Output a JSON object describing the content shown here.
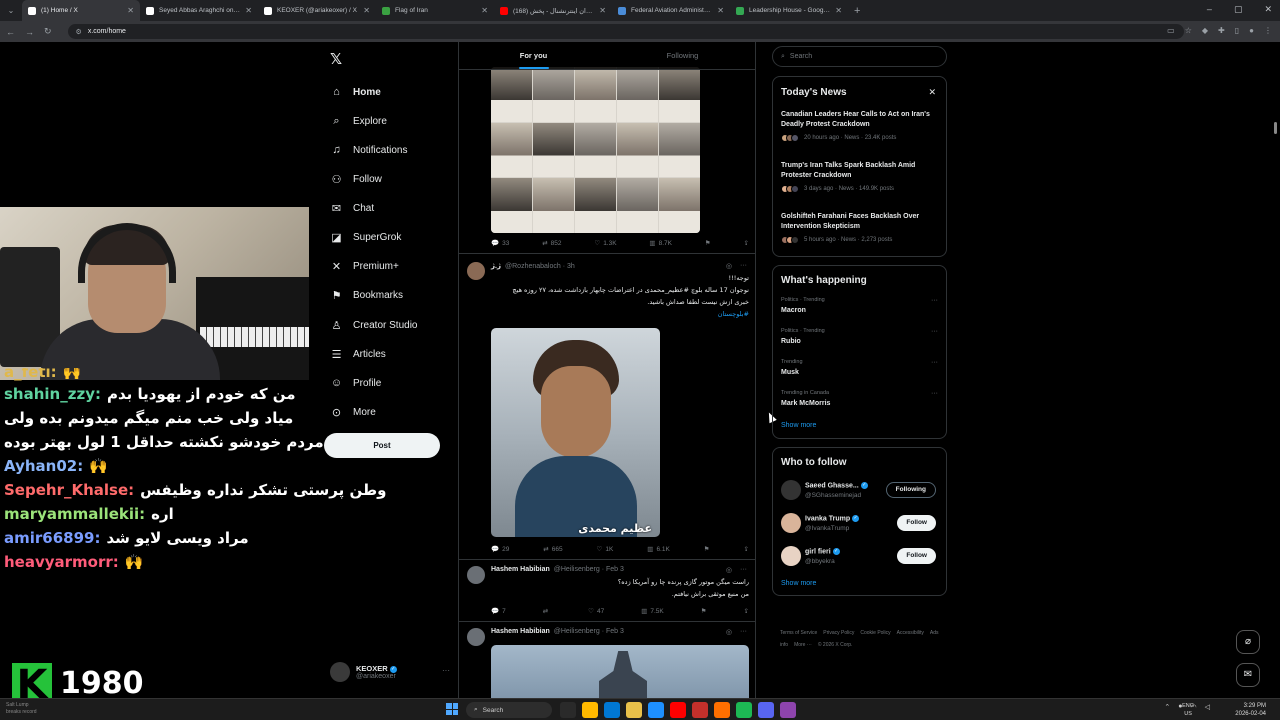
{
  "browser": {
    "tabs": [
      {
        "title": "(1) Home / X",
        "active": true,
        "favicon_color": "#ffffff"
      },
      {
        "title": "Seyed Abbas Araghchi on X: \"I...",
        "active": false,
        "favicon_color": "#ffffff"
      },
      {
        "title": "KEOXER (@ariakeoxer) / X",
        "active": false,
        "favicon_color": "#ffffff"
      },
      {
        "title": "Flag of Iran",
        "active": false,
        "favicon_color": "#3aa142"
      },
      {
        "title": "(168) ایران اینترنشنال - پخش...",
        "active": false,
        "favicon_color": "#ff0000"
      },
      {
        "title": "Federal Aviation Administratio...",
        "active": false,
        "favicon_color": "#4a8cd8"
      },
      {
        "title": "Leadership House - Google Ma...",
        "active": false,
        "favicon_color": "#34a853"
      }
    ],
    "new_tab_symbol": "+",
    "url": "x.com/home"
  },
  "stream": {
    "chat": [
      {
        "user": "a_feti:",
        "message": "🙌",
        "user_color": "#e0b84b",
        "partial": true
      },
      {
        "user": "shahin_zzy:",
        "message": "من که خودم از یهودیا بدم میاد ولی خب منم میگم میدونم بده ولی مردم خودشو نکشته حداقل 1 لول بهتر بوده",
        "user_color": "#5fd3a0"
      },
      {
        "user": "Ayhan02:",
        "message": "🙌",
        "user_color": "#8ab4f8"
      },
      {
        "user": "Sepehr_Khalse:",
        "message": "وطن پرستی تشکر نداره وظیفس",
        "user_color": "#ff6b6b"
      },
      {
        "user": "maryammallekii:",
        "message": "اره",
        "user_color": "#9be37a"
      },
      {
        "user": "amir66899:",
        "message": "مراد ویسی لایو شد",
        "user_color": "#7a9cff"
      },
      {
        "user": "heavyarmorr:",
        "message": "🙌",
        "user_color": "#ff5c7a"
      }
    ],
    "sub_badge": "K",
    "sub_count": "1980",
    "sub_caption": "breaks record"
  },
  "nav": {
    "items": [
      {
        "label": "Home",
        "icon": "home-icon",
        "glyph": "⌂",
        "active": true
      },
      {
        "label": "Explore",
        "icon": "search-icon",
        "glyph": "⌕"
      },
      {
        "label": "Notifications",
        "icon": "bell-icon",
        "glyph": "♫"
      },
      {
        "label": "Follow",
        "icon": "follow-icon",
        "glyph": "⚇"
      },
      {
        "label": "Chat",
        "icon": "chat-icon",
        "glyph": "✉"
      },
      {
        "label": "SuperGrok",
        "icon": "grok-icon",
        "glyph": "◪"
      },
      {
        "label": "Premium+",
        "icon": "x-premium-icon",
        "glyph": "✕"
      },
      {
        "label": "Bookmarks",
        "icon": "bookmark-icon",
        "glyph": "⚑"
      },
      {
        "label": "Creator Studio",
        "icon": "creator-studio-icon",
        "glyph": "♙"
      },
      {
        "label": "Articles",
        "icon": "articles-icon",
        "glyph": "☰"
      },
      {
        "label": "Profile",
        "icon": "profile-icon",
        "glyph": "☺"
      },
      {
        "label": "More",
        "icon": "more-icon",
        "glyph": "⊙"
      }
    ],
    "post_label": "Post",
    "account_name": "KEOXER",
    "account_handle": "@ariakeoxer"
  },
  "feed": {
    "tabs": [
      "For you",
      "Following"
    ],
    "post1": {
      "replies": "33",
      "reposts": "852",
      "likes": "1.3K",
      "views": "8.7K"
    },
    "post2": {
      "name": "ژ.ژ",
      "handle": "@Rozhenabaloch · 3h",
      "line1": "توجه!!!",
      "line2": "نوجوان 17 ساله بلوچ #عظیم_محمدی در اعتراضات چابهار بازداشت شده، ۲۷ روزه هیچ",
      "line3": "خبری ازش نیست لطفا صداش باشید.",
      "tag": "#بلوچستان",
      "image_caption": "عظیم محمدی",
      "replies": "29",
      "reposts": "665",
      "likes": "1K",
      "views": "6.1K"
    },
    "post3": {
      "name": "Hashem Habibian",
      "handle": "@Heilisenberg · Feb 3",
      "line1": "راست میگن موتور گازی پرنده چا رو آمریکا زده؟",
      "line2": "من منبع موثقی براش نیافتم.",
      "replies": "7",
      "reposts": "",
      "likes": "47",
      "views": "7.5K"
    },
    "post4": {
      "name": "Hashem Habibian",
      "handle": "@Heilisenberg · Feb 3"
    }
  },
  "sidebar": {
    "search_placeholder": "Search",
    "news_title": "Today's News",
    "news": [
      {
        "title": "Canadian Leaders Hear Calls to Act on Iran's Deadly Protest Crackdown",
        "meta": "20 hours ago · News · 23.4K posts"
      },
      {
        "title": "Trump's Iran Talks Spark Backlash Amid Protester Crackdown",
        "meta": "3 days ago · News · 149.9K posts"
      },
      {
        "title": "Golshifteh Farahani Faces Backlash Over Intervention Skepticism",
        "meta": "5 hours ago · News · 2,273 posts"
      }
    ],
    "happening_title": "What's happening",
    "trends": [
      {
        "context": "Politics · Trending",
        "name": "Macron"
      },
      {
        "context": "Politics · Trending",
        "name": "Rubio"
      },
      {
        "context": "Trending",
        "name": "Musk"
      },
      {
        "context": "Trending in Canada",
        "name": "Mark McMorris"
      }
    ],
    "show_more": "Show more",
    "wtf_title": "Who to follow",
    "who_to_follow": [
      {
        "name": "Saeed Ghasse...",
        "handle": "@SGhasseminejad",
        "button": "Following"
      },
      {
        "name": "Ivanka Trump",
        "handle": "@IvankaTrump",
        "button": "Follow"
      },
      {
        "name": "girl fieri",
        "handle": "@bbyekra",
        "button": "Follow"
      }
    ],
    "footer": [
      "Terms of Service",
      "Privacy Policy",
      "Cookie Policy",
      "Accessibility",
      "Ads info",
      "More ···",
      "© 2026 X Corp."
    ]
  },
  "taskbar": {
    "search_label": "Search",
    "lang_top": "ENG",
    "lang_bottom": "US",
    "time": "3:29 PM",
    "date": "2026-02-04",
    "left_line1": "Salt Lump",
    "left_line2": "breaks record"
  },
  "colors": {
    "accent": "#1d9bf0",
    "background": "#000000",
    "border": "#2f3336"
  }
}
